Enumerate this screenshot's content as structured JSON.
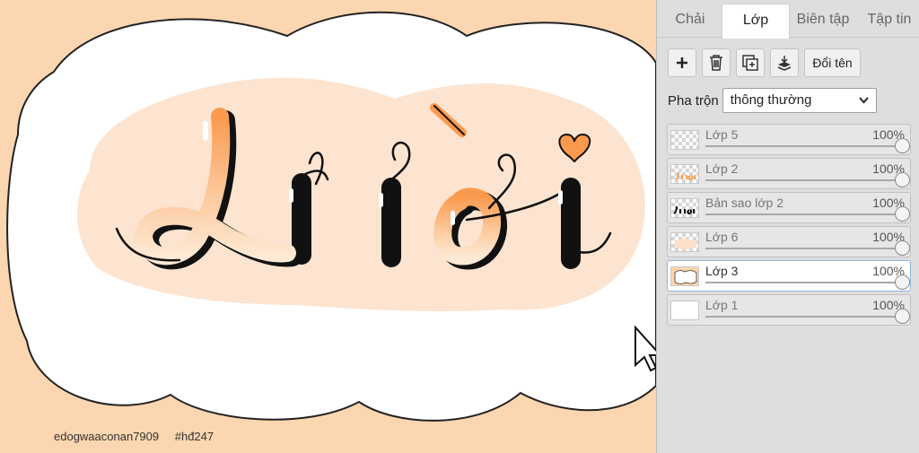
{
  "canvas": {
    "text": "Lười",
    "credit": {
      "user": "edogwaaconan7909",
      "hashtag": "#hđ247"
    },
    "colors": {
      "background": "#fcd6b0",
      "cloud": "#ffffff",
      "glow": "#fde4d0",
      "letter_top": "#fa9a4e",
      "letter_bottom": "#fde9d4",
      "outline": "#111111"
    }
  },
  "panel": {
    "tabs": [
      {
        "label": "Chải",
        "active": false
      },
      {
        "label": "Lớp",
        "active": true
      },
      {
        "label": "Biên tập",
        "active": false
      },
      {
        "label": "Tập tin",
        "active": false
      }
    ],
    "toolbar": {
      "add_icon": "plus-icon",
      "delete_icon": "trash-icon",
      "duplicate_icon": "duplicate-layer-icon",
      "merge_icon": "merge-down-icon",
      "rename_label": "Đổi tên"
    },
    "blend": {
      "label": "Pha trộn",
      "value": "thông thường"
    },
    "layers": [
      {
        "name": "Lớp 5",
        "opacity": "100%",
        "opacity_value": 1.0,
        "selected": false,
        "thumb": "transparent"
      },
      {
        "name": "Lớp 2",
        "opacity": "100%",
        "opacity_value": 1.0,
        "selected": false,
        "thumb": "orange-text"
      },
      {
        "name": "Bản sao lớp 2",
        "opacity": "100%",
        "opacity_value": 1.0,
        "selected": false,
        "thumb": "dark-text"
      },
      {
        "name": "Lớp 6",
        "opacity": "100%",
        "opacity_value": 1.0,
        "selected": false,
        "thumb": "peach-blob"
      },
      {
        "name": "Lớp 3",
        "opacity": "100%",
        "opacity_value": 1.0,
        "selected": true,
        "thumb": "cloud"
      },
      {
        "name": "Lớp 1",
        "opacity": "100%",
        "opacity_value": 1.0,
        "selected": false,
        "thumb": "white"
      }
    ]
  }
}
